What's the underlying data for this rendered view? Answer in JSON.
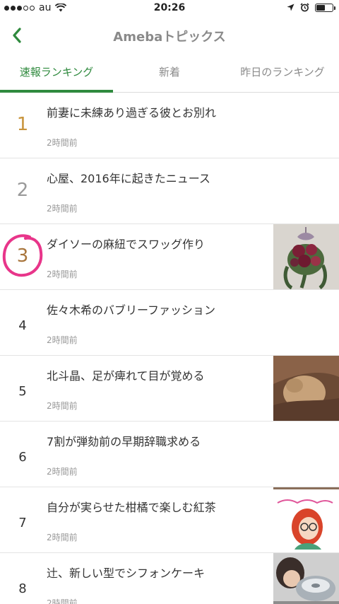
{
  "status_bar": {
    "carrier": "au",
    "time": "20:26"
  },
  "nav": {
    "title": "Amebaトピックス"
  },
  "tabs": [
    {
      "label": "速報ランキング",
      "active": true
    },
    {
      "label": "新着",
      "active": false
    },
    {
      "label": "昨日のランキング",
      "active": false
    }
  ],
  "items": [
    {
      "rank": "1",
      "title": "前妻に未練あり過ぎる彼とお別れ",
      "time": "2時間前"
    },
    {
      "rank": "2",
      "title": "心屋、2016年に起きたニュース",
      "time": "2時間前"
    },
    {
      "rank": "3",
      "title": "ダイソーの麻紐でスワッグ作り",
      "time": "2時間前"
    },
    {
      "rank": "4",
      "title": "佐々木希のバブリーファッション",
      "time": "2時間前"
    },
    {
      "rank": "5",
      "title": "北斗晶、足が痺れて目が覚める",
      "time": "2時間前"
    },
    {
      "rank": "6",
      "title": "7割が弾劾前の早期辞職求める",
      "time": "2時間前"
    },
    {
      "rank": "7",
      "title": "自分が実らせた柑橘で楽しむ紅茶",
      "time": "2時間前"
    },
    {
      "rank": "8",
      "title": "辻、新しい型でシフォンケーキ",
      "time": "2時間前"
    }
  ],
  "colors": {
    "accent": "#2f8a3e",
    "annotation": "#e8358a"
  }
}
